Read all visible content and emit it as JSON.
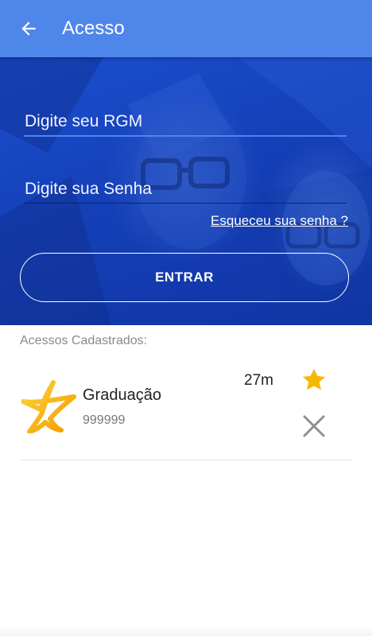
{
  "appbar": {
    "title": "Acesso",
    "back_icon": "arrow-left-icon"
  },
  "login": {
    "rgm_placeholder": "Digite seu RGM",
    "password_placeholder": "Digite sua Senha",
    "forgot_link": "Esqueceu sua senha ?",
    "enter_button": "ENTRAR"
  },
  "accounts": {
    "section_label": "Acessos Cadastrados:",
    "items": [
      {
        "name": "Graduação",
        "rgm": "999999",
        "time": "27m",
        "favorite_icon": "star-icon",
        "delete_icon": "close-icon"
      }
    ]
  },
  "colors": {
    "appbar": "#4f86ea",
    "hero": "#1540b8",
    "accent_underline": "#4f86ea",
    "star": "#f5b800",
    "muted_text": "#8a8a8a"
  }
}
